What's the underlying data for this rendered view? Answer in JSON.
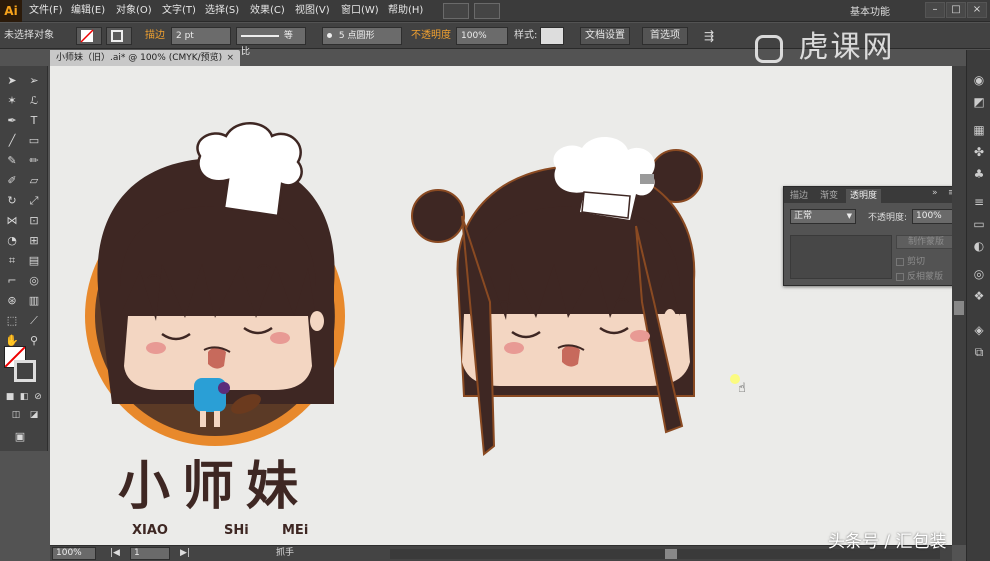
{
  "app": {
    "logo_text": "Ai",
    "workspace": "基本功能"
  },
  "menu": [
    "文件(F)",
    "编辑(E)",
    "对象(O)",
    "文字(T)",
    "选择(S)",
    "效果(C)",
    "视图(V)",
    "窗口(W)",
    "帮助(H)"
  ],
  "controlbar": {
    "selection_status": "未选择对象",
    "stroke_label": "描边",
    "stroke_weight": "2 pt",
    "stroke_profile": "等比",
    "brush": "5 点圆形",
    "opacity_label": "不透明度",
    "opacity_value": "100%",
    "style_label": "样式:",
    "doc_setup_button": "文档设置",
    "preferences_button": "首选项"
  },
  "document_tab": {
    "title": "小师妹（旧）.ai* @ 100% (CMYK/预览)"
  },
  "artwork": {
    "title_chars": "小师妹",
    "pinyin": [
      "XIAO",
      "SHi",
      "MEi"
    ],
    "colors": {
      "hair": "#3e2723",
      "skin": "#f3d6c2",
      "cheek": "#e89a94",
      "tongue": "#c76a5c",
      "orange_ring": "#e8892c",
      "dress": "#2a9fd6",
      "outline": "#8a4a22",
      "hat": "#ffffff"
    }
  },
  "transparency_panel": {
    "tabs": [
      "描边",
      "渐变",
      "透明度"
    ],
    "active_tab": "透明度",
    "blend_mode": "正常",
    "opacity_label": "不透明度:",
    "opacity_value": "100%",
    "make_mask_button": "制作蒙版",
    "clip_label": "剪切",
    "invert_mask_label": "反相蒙版"
  },
  "statusbar": {
    "zoom": "100%",
    "artboard": "1",
    "tool_name": "抓手"
  },
  "watermarks": {
    "top_logo": "虎课网",
    "bottom_text": "头条号 / 汇包装"
  }
}
